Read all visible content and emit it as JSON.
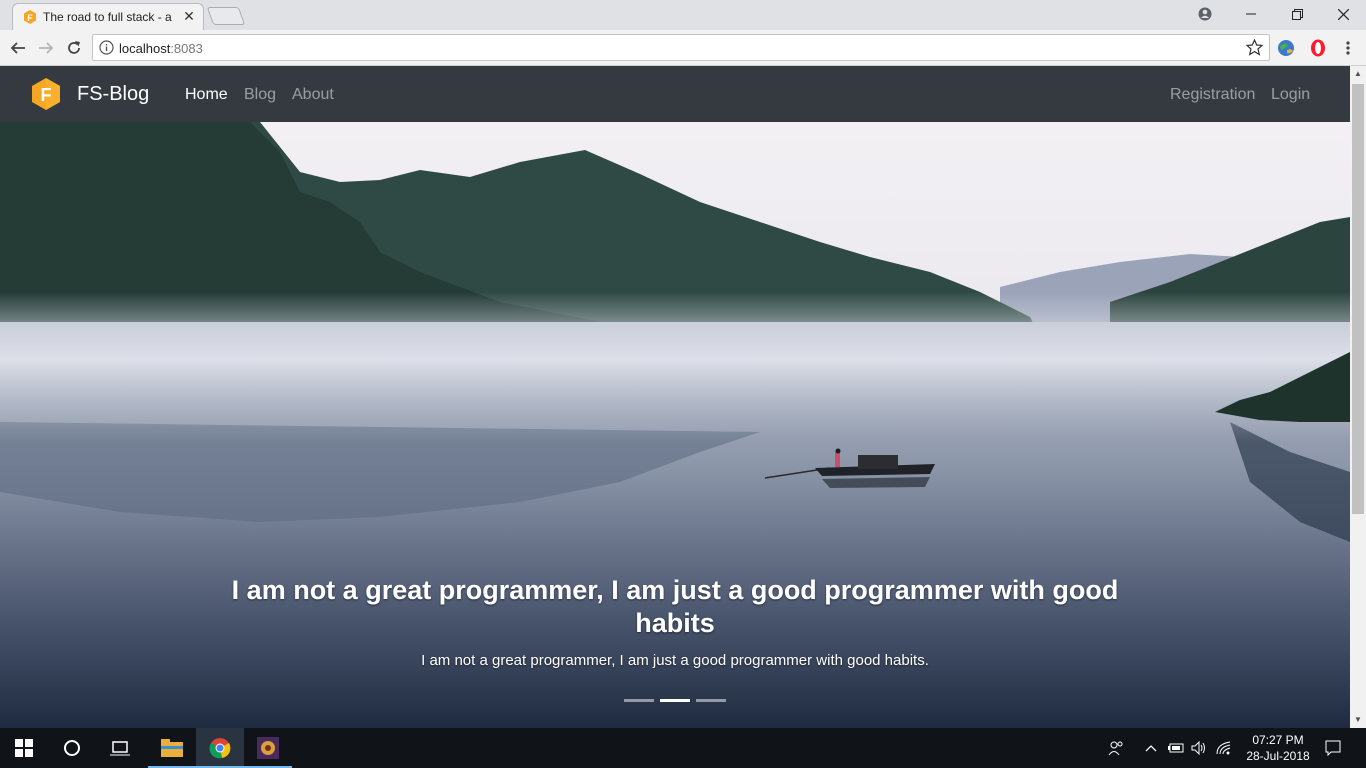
{
  "browser": {
    "tab_title": "The road to full stack - a",
    "url_host": "localhost",
    "url_port": ":8083"
  },
  "site": {
    "brand": "FS-Blog",
    "brand_letter": "F",
    "nav_left": [
      "Home",
      "Blog",
      "About"
    ],
    "nav_right": [
      "Registration",
      "Login"
    ],
    "active_nav": "Home",
    "colors": {
      "navbar": "#343a40",
      "logo": "#f5a623"
    }
  },
  "carousel": {
    "title": "I am not a great programmer, I am just a good programmer with good habits",
    "text": "I am not a great programmer, I am just a good programmer with good habits.",
    "indicators": 3,
    "active_indicator": 2
  },
  "taskbar": {
    "time": "07:27 PM",
    "date": "28-Jul-2018"
  }
}
